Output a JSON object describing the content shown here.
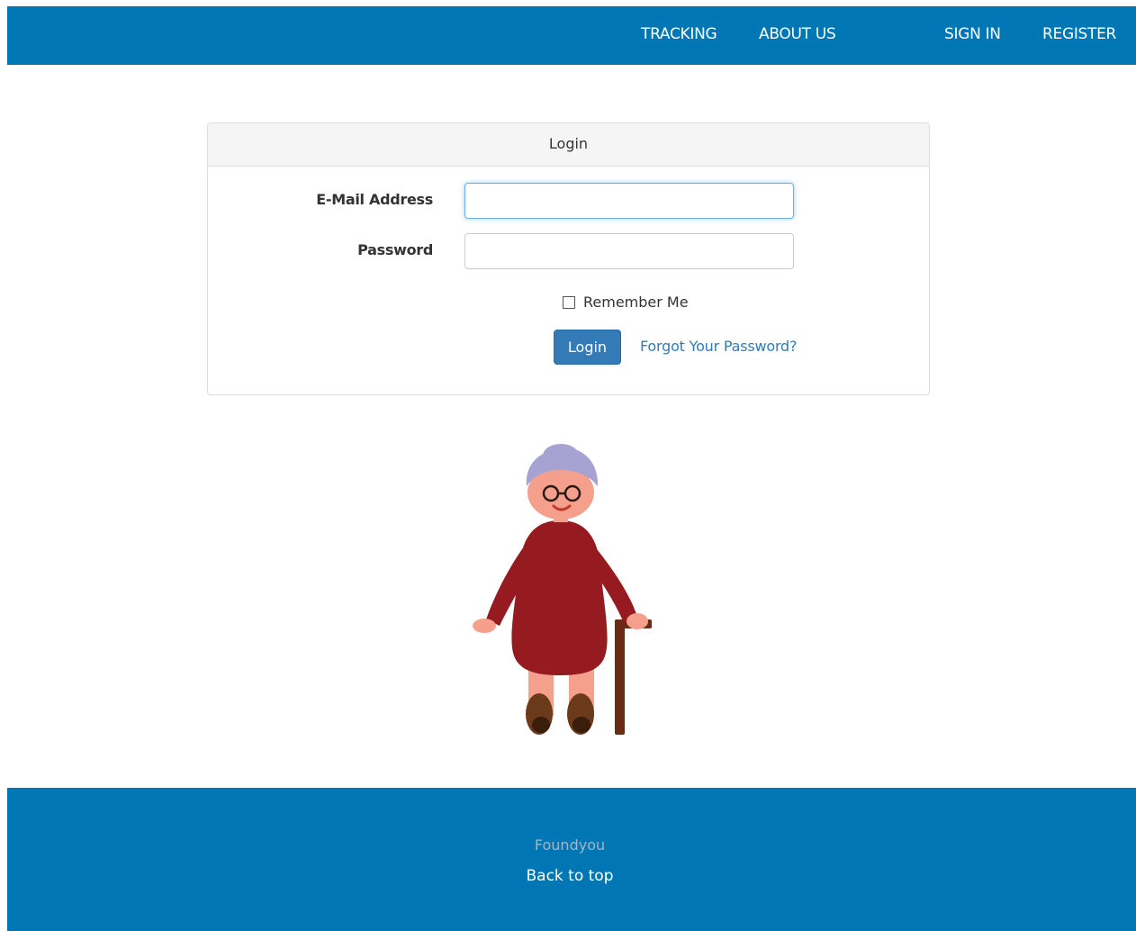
{
  "navbar": {
    "links": {
      "tracking": "TRACKING",
      "about": "ABOUT US",
      "signin": "SIGN IN",
      "register": "REGISTER"
    },
    "bg_color": "#0077b5"
  },
  "login_panel": {
    "heading": "Login",
    "email_label": "E-Mail Address",
    "email_value": "",
    "password_label": "Password",
    "password_value": "",
    "remember_label": "Remember Me",
    "remember_checked": false,
    "login_button": "Login",
    "forgot_link": "Forgot Your Password?",
    "button_color": "#337ab7"
  },
  "illustration": {
    "subject": "elderly-woman-with-cane-illustration"
  },
  "footer": {
    "brand": "Foundyou",
    "back_to_top": "Back to top",
    "bg_color": "#0077b5"
  }
}
